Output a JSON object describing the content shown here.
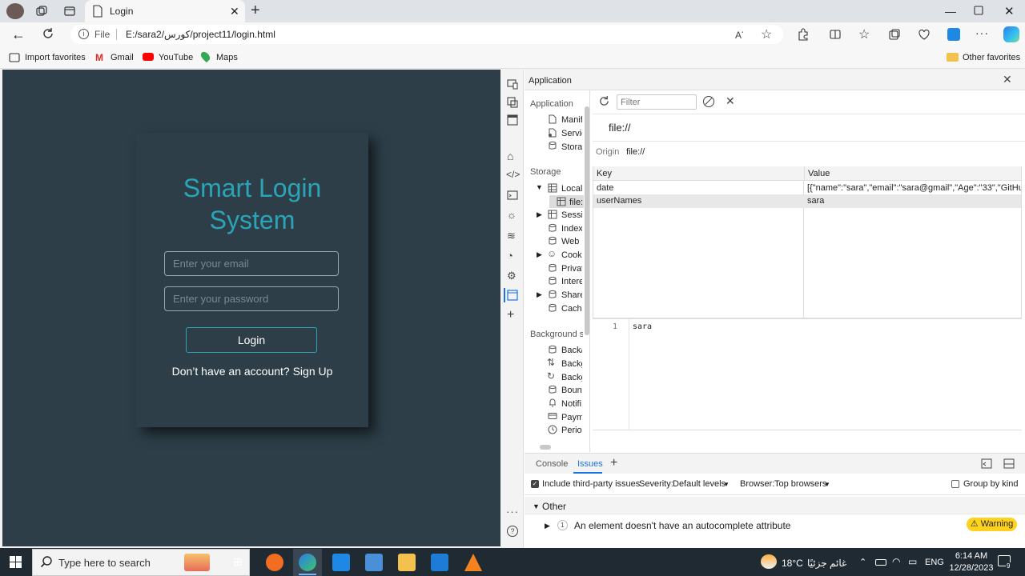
{
  "browser": {
    "tab_title": "Login",
    "address": "E:/sara2/كورس/project11/login.html",
    "file_label": "File",
    "favorites": [
      "Import favorites",
      "Gmail",
      "YouTube",
      "Maps"
    ],
    "other_favorites": "Other favorites"
  },
  "page": {
    "title": "Smart Login System",
    "email_placeholder": "Enter your email",
    "password_placeholder": "Enter your password",
    "login_label": "Login",
    "signup_text": "Don’t have an account? Sign Up"
  },
  "devtools": {
    "panel_title": "Application",
    "filter_placeholder": "Filter",
    "origin_heading": "file://",
    "origin_label": "Origin",
    "origin_value": "file://",
    "sidebar": {
      "application_header": "Application",
      "application_items": [
        "Manif",
        "Servic",
        "Storag"
      ],
      "storage_header": "Storage",
      "storage_items": [
        "Local",
        "file:",
        "Sessic",
        "Indexe",
        "Web S",
        "Cooki",
        "Privat",
        "Intere",
        "Share",
        "Cache"
      ],
      "background_header": "Background se",
      "background_items": [
        "Back/f",
        "Backg",
        "Backg",
        "Bounc",
        "Notifi",
        "Payme",
        "Perioc"
      ]
    },
    "table": {
      "headers": [
        "Key",
        "Value"
      ],
      "rows": [
        {
          "key": "date",
          "value": "[{\"name\":\"sara\",\"email\":\"sara@gmail\",\"Age\":\"33\",\"GitHub..."
        },
        {
          "key": "userNames",
          "value": "sara"
        }
      ]
    },
    "editor": {
      "line": "1",
      "content": "sara"
    },
    "drawer": {
      "tabs": [
        "Console",
        "Issues"
      ],
      "include_third_party": "Include third-party issues",
      "severity_label": "Severity:",
      "severity_value": "Default levels",
      "browser_label": "Browser:",
      "browser_value": "Top browsers",
      "group_by_kind": "Group by kind",
      "section": "Other",
      "issue_count": "1",
      "issue_text": "An element doesn't have an autocomplete attribute",
      "warning_label": "Warning"
    }
  },
  "taskbar": {
    "search_placeholder": "Type here to search",
    "weather_temp": "18°C",
    "weather_desc": "غائم جزئيًا",
    "language": "ENG",
    "time": "6:14 AM",
    "date": "12/28/2023",
    "notification_count": "9"
  },
  "colors": {
    "page_bg": "#2d3e48",
    "accent": "#2aa5b8",
    "issues_tab": "#1a73e8",
    "warning": "#ffd21f"
  }
}
